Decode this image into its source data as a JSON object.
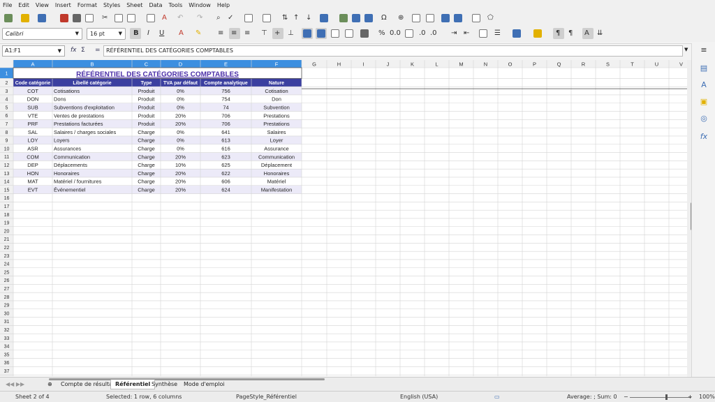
{
  "menu": [
    "File",
    "Edit",
    "View",
    "Insert",
    "Format",
    "Styles",
    "Sheet",
    "Data",
    "Tools",
    "Window",
    "Help"
  ],
  "toolbar": {
    "font_name": "Calibri",
    "font_size": "16 pt"
  },
  "formula_bar": {
    "name_box": "A1:F1",
    "content": "RÉFÉRENTIEL DES CATÉGORIES COMPTABLES",
    "fx": "fx",
    "sigma": "Σ",
    "equals": "="
  },
  "columns": [
    "A",
    "B",
    "C",
    "D",
    "E",
    "F",
    "G",
    "H",
    "I",
    "J",
    "K",
    "L",
    "M",
    "N",
    "O",
    "P",
    "Q",
    "R",
    "S",
    "T",
    "U",
    "V"
  ],
  "rows": [
    "1",
    "2",
    "3",
    "4",
    "5",
    "6",
    "7",
    "8",
    "9",
    "10",
    "11",
    "12",
    "13",
    "14",
    "15",
    "16",
    "17",
    "18",
    "19",
    "20",
    "21",
    "22",
    "23",
    "24",
    "25",
    "26",
    "27",
    "28",
    "29",
    "30",
    "31",
    "32",
    "33",
    "34",
    "35",
    "36",
    "37"
  ],
  "sheet": {
    "title": "RÉFÉRENTIEL DES CATÉGORIES COMPTABLES",
    "headers": [
      "Code catégorie",
      "Libellé catégorie",
      "Type",
      "TVA par défaut",
      "Compte analytique",
      "Nature"
    ],
    "data": [
      [
        "COT",
        "Cotisations",
        "Produit",
        "0%",
        "756",
        "Cotisation"
      ],
      [
        "DON",
        "Dons",
        "Produit",
        "0%",
        "754",
        "Don"
      ],
      [
        "SUB",
        "Subventions d'exploitation",
        "Produit",
        "0%",
        "74",
        "Subvention"
      ],
      [
        "VTE",
        "Ventes de prestations",
        "Produit",
        "20%",
        "706",
        "Prestations"
      ],
      [
        "PRF",
        "Prestations facturées",
        "Produit",
        "20%",
        "706",
        "Prestations"
      ],
      [
        "SAL",
        "Salaires / charges sociales",
        "Charge",
        "0%",
        "641",
        "Salaires"
      ],
      [
        "LOY",
        "Loyers",
        "Charge",
        "0%",
        "613",
        "Loyer"
      ],
      [
        "ASR",
        "Assurances",
        "Charge",
        "0%",
        "616",
        "Assurance"
      ],
      [
        "COM",
        "Communication",
        "Charge",
        "20%",
        "623",
        "Communication"
      ],
      [
        "DEP",
        "Déplacements",
        "Charge",
        "10%",
        "625",
        "Déplacement"
      ],
      [
        "HON",
        "Honoraires",
        "Charge",
        "20%",
        "622",
        "Honoraires"
      ],
      [
        "MAT",
        "Matériel / fournitures",
        "Charge",
        "20%",
        "606",
        "Matériel"
      ],
      [
        "EVT",
        "Événementiel",
        "Charge",
        "20%",
        "624",
        "Manifestation"
      ]
    ]
  },
  "tabs": [
    "Compte de résultat",
    "Référentiel",
    "Synthèse",
    "Mode d'emploi"
  ],
  "active_tab": "Référentiel",
  "status": {
    "sheet": "Sheet 2 of 4",
    "selection": "Selected: 1 row, 6 columns",
    "page_style": "PageStyle_Référentiel",
    "language": "English (USA)",
    "summary": "Average: ; Sum: 0",
    "zoom": "100%"
  },
  "colors": {
    "header_bg": "#3b3fa0",
    "title_color": "#4b2fa8",
    "selected_col": "#3c8fe0",
    "row_band": "#eceaf8"
  }
}
